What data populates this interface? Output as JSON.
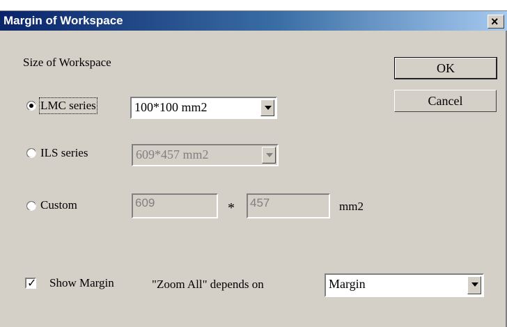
{
  "dialog": {
    "title": "Margin of Workspace",
    "close_glyph": "×"
  },
  "workspace": {
    "group_label": "Size of Workspace",
    "lmc": {
      "label": "LMC series",
      "value": "100*100 mm2",
      "selected": true
    },
    "ils": {
      "label": "ILS series",
      "value": "609*457 mm2",
      "selected": false
    },
    "custom": {
      "label": "Custom",
      "width": "609",
      "separator": "*",
      "height": "457",
      "unit": "mm2",
      "selected": false
    }
  },
  "buttons": {
    "ok": "OK",
    "cancel": "Cancel"
  },
  "margin": {
    "show_label": "Show Margin",
    "show_checked": true,
    "check_glyph": "✓",
    "zoom_label": "\"Zoom All\" depends on",
    "zoom_value": "Margin"
  }
}
